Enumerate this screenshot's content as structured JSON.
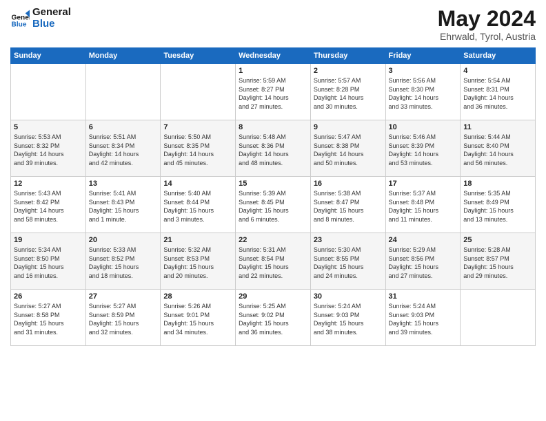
{
  "logo": {
    "line1": "General",
    "line2": "Blue"
  },
  "title": "May 2024",
  "subtitle": "Ehrwald, Tyrol, Austria",
  "headers": [
    "Sunday",
    "Monday",
    "Tuesday",
    "Wednesday",
    "Thursday",
    "Friday",
    "Saturday"
  ],
  "weeks": [
    [
      {
        "day": "",
        "info": ""
      },
      {
        "day": "",
        "info": ""
      },
      {
        "day": "",
        "info": ""
      },
      {
        "day": "1",
        "info": "Sunrise: 5:59 AM\nSunset: 8:27 PM\nDaylight: 14 hours\nand 27 minutes."
      },
      {
        "day": "2",
        "info": "Sunrise: 5:57 AM\nSunset: 8:28 PM\nDaylight: 14 hours\nand 30 minutes."
      },
      {
        "day": "3",
        "info": "Sunrise: 5:56 AM\nSunset: 8:30 PM\nDaylight: 14 hours\nand 33 minutes."
      },
      {
        "day": "4",
        "info": "Sunrise: 5:54 AM\nSunset: 8:31 PM\nDaylight: 14 hours\nand 36 minutes."
      }
    ],
    [
      {
        "day": "5",
        "info": "Sunrise: 5:53 AM\nSunset: 8:32 PM\nDaylight: 14 hours\nand 39 minutes."
      },
      {
        "day": "6",
        "info": "Sunrise: 5:51 AM\nSunset: 8:34 PM\nDaylight: 14 hours\nand 42 minutes."
      },
      {
        "day": "7",
        "info": "Sunrise: 5:50 AM\nSunset: 8:35 PM\nDaylight: 14 hours\nand 45 minutes."
      },
      {
        "day": "8",
        "info": "Sunrise: 5:48 AM\nSunset: 8:36 PM\nDaylight: 14 hours\nand 48 minutes."
      },
      {
        "day": "9",
        "info": "Sunrise: 5:47 AM\nSunset: 8:38 PM\nDaylight: 14 hours\nand 50 minutes."
      },
      {
        "day": "10",
        "info": "Sunrise: 5:46 AM\nSunset: 8:39 PM\nDaylight: 14 hours\nand 53 minutes."
      },
      {
        "day": "11",
        "info": "Sunrise: 5:44 AM\nSunset: 8:40 PM\nDaylight: 14 hours\nand 56 minutes."
      }
    ],
    [
      {
        "day": "12",
        "info": "Sunrise: 5:43 AM\nSunset: 8:42 PM\nDaylight: 14 hours\nand 58 minutes."
      },
      {
        "day": "13",
        "info": "Sunrise: 5:41 AM\nSunset: 8:43 PM\nDaylight: 15 hours\nand 1 minute."
      },
      {
        "day": "14",
        "info": "Sunrise: 5:40 AM\nSunset: 8:44 PM\nDaylight: 15 hours\nand 3 minutes."
      },
      {
        "day": "15",
        "info": "Sunrise: 5:39 AM\nSunset: 8:45 PM\nDaylight: 15 hours\nand 6 minutes."
      },
      {
        "day": "16",
        "info": "Sunrise: 5:38 AM\nSunset: 8:47 PM\nDaylight: 15 hours\nand 8 minutes."
      },
      {
        "day": "17",
        "info": "Sunrise: 5:37 AM\nSunset: 8:48 PM\nDaylight: 15 hours\nand 11 minutes."
      },
      {
        "day": "18",
        "info": "Sunrise: 5:35 AM\nSunset: 8:49 PM\nDaylight: 15 hours\nand 13 minutes."
      }
    ],
    [
      {
        "day": "19",
        "info": "Sunrise: 5:34 AM\nSunset: 8:50 PM\nDaylight: 15 hours\nand 16 minutes."
      },
      {
        "day": "20",
        "info": "Sunrise: 5:33 AM\nSunset: 8:52 PM\nDaylight: 15 hours\nand 18 minutes."
      },
      {
        "day": "21",
        "info": "Sunrise: 5:32 AM\nSunset: 8:53 PM\nDaylight: 15 hours\nand 20 minutes."
      },
      {
        "day": "22",
        "info": "Sunrise: 5:31 AM\nSunset: 8:54 PM\nDaylight: 15 hours\nand 22 minutes."
      },
      {
        "day": "23",
        "info": "Sunrise: 5:30 AM\nSunset: 8:55 PM\nDaylight: 15 hours\nand 24 minutes."
      },
      {
        "day": "24",
        "info": "Sunrise: 5:29 AM\nSunset: 8:56 PM\nDaylight: 15 hours\nand 27 minutes."
      },
      {
        "day": "25",
        "info": "Sunrise: 5:28 AM\nSunset: 8:57 PM\nDaylight: 15 hours\nand 29 minutes."
      }
    ],
    [
      {
        "day": "26",
        "info": "Sunrise: 5:27 AM\nSunset: 8:58 PM\nDaylight: 15 hours\nand 31 minutes."
      },
      {
        "day": "27",
        "info": "Sunrise: 5:27 AM\nSunset: 8:59 PM\nDaylight: 15 hours\nand 32 minutes."
      },
      {
        "day": "28",
        "info": "Sunrise: 5:26 AM\nSunset: 9:01 PM\nDaylight: 15 hours\nand 34 minutes."
      },
      {
        "day": "29",
        "info": "Sunrise: 5:25 AM\nSunset: 9:02 PM\nDaylight: 15 hours\nand 36 minutes."
      },
      {
        "day": "30",
        "info": "Sunrise: 5:24 AM\nSunset: 9:03 PM\nDaylight: 15 hours\nand 38 minutes."
      },
      {
        "day": "31",
        "info": "Sunrise: 5:24 AM\nSunset: 9:03 PM\nDaylight: 15 hours\nand 39 minutes."
      },
      {
        "day": "",
        "info": ""
      }
    ]
  ]
}
